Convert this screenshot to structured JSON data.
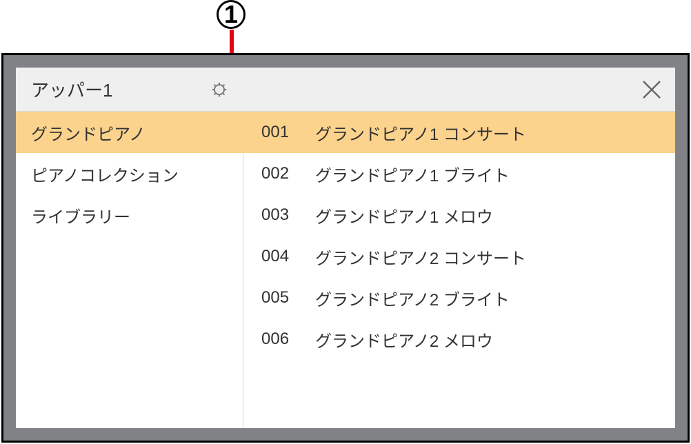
{
  "callout": {
    "number": "1"
  },
  "header": {
    "title": "アッパー1"
  },
  "categories": [
    {
      "label": "グランドピアノ",
      "selected": true
    },
    {
      "label": "ピアノコレクション",
      "selected": false
    },
    {
      "label": "ライブラリー",
      "selected": false
    }
  ],
  "items": [
    {
      "num": "001",
      "name": "グランドピアノ1 コンサート",
      "selected": true
    },
    {
      "num": "002",
      "name": "グランドピアノ1 ブライト",
      "selected": false
    },
    {
      "num": "003",
      "name": "グランドピアノ1 メロウ",
      "selected": false
    },
    {
      "num": "004",
      "name": "グランドピアノ2 コンサート",
      "selected": false
    },
    {
      "num": "005",
      "name": "グランドピアノ2 ブライト",
      "selected": false
    },
    {
      "num": "006",
      "name": "グランドピアノ2 メロウ",
      "selected": false
    }
  ]
}
